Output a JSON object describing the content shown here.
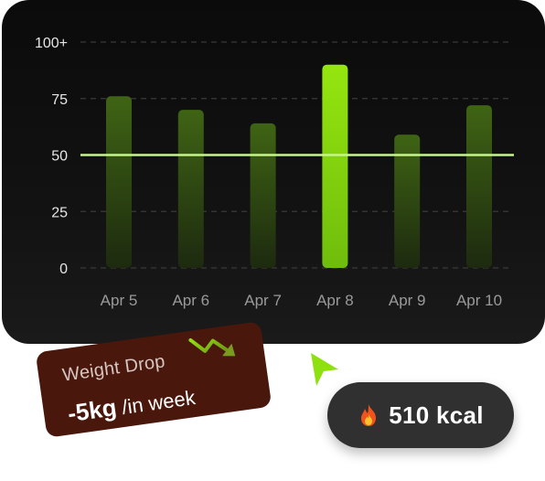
{
  "chart_data": {
    "type": "bar",
    "categories": [
      "Apr 5",
      "Apr 6",
      "Apr 7",
      "Apr 8",
      "Apr 9",
      "Apr 10"
    ],
    "values": [
      76,
      70,
      64,
      90,
      59,
      72
    ],
    "highlighted_category": "Apr 8",
    "reference_line": 50,
    "y_ticks": [
      "0",
      "25",
      "50",
      "75",
      "100+"
    ],
    "ylim": [
      0,
      100
    ],
    "grid": true,
    "title": "",
    "xlabel": "",
    "ylabel": "",
    "colors": {
      "bar": "#3f6414",
      "bar_highlight": "#8fe00f",
      "reference_line": "#c6f58a",
      "grid": "#3a3a3a",
      "tick_label": "#9a9a9a"
    }
  },
  "weight_card": {
    "title": "Weight Drop",
    "value": "-5kg",
    "unit": "/in week",
    "icon": "trend-down-icon",
    "background": "#4a170c"
  },
  "calories": {
    "icon": "fire-icon",
    "value": "510 kcal"
  },
  "cursor": {
    "icon": "cursor-arrow-icon",
    "color": "#8fe00f"
  }
}
